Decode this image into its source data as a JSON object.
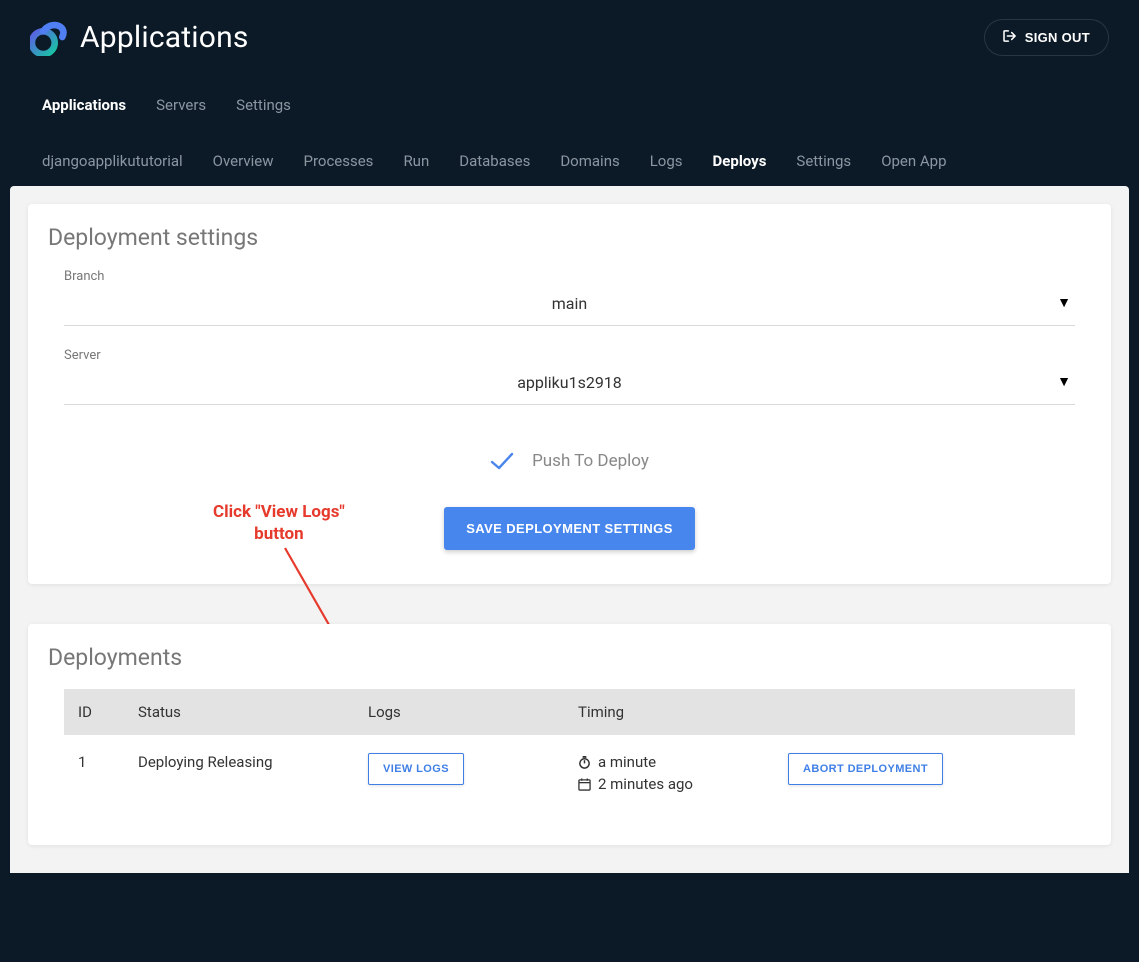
{
  "header": {
    "title": "Applications",
    "signout_label": "SIGN OUT"
  },
  "top_nav": [
    {
      "label": "Applications",
      "active": true
    },
    {
      "label": "Servers",
      "active": false
    },
    {
      "label": "Settings",
      "active": false
    }
  ],
  "sub_nav": [
    {
      "label": "djangoapplikututorial",
      "active": false
    },
    {
      "label": "Overview",
      "active": false
    },
    {
      "label": "Processes",
      "active": false
    },
    {
      "label": "Run",
      "active": false
    },
    {
      "label": "Databases",
      "active": false
    },
    {
      "label": "Domains",
      "active": false
    },
    {
      "label": "Logs",
      "active": false
    },
    {
      "label": "Deploys",
      "active": true
    },
    {
      "label": "Settings",
      "active": false
    },
    {
      "label": "Open App",
      "active": false
    }
  ],
  "deployment_settings": {
    "title": "Deployment settings",
    "branch_label": "Branch",
    "branch_value": "main",
    "server_label": "Server",
    "server_value": "appliku1s2918",
    "push_to_deploy_label": "Push To Deploy",
    "push_to_deploy_checked": true,
    "save_button": "SAVE DEPLOYMENT SETTINGS"
  },
  "annotation": {
    "line1": "Click \"View Logs\"",
    "line2": "button"
  },
  "deployments": {
    "title": "Deployments",
    "columns": [
      "ID",
      "Status",
      "Logs",
      "Timing",
      ""
    ],
    "rows": [
      {
        "id": "1",
        "status": "Deploying Releasing",
        "view_logs_label": "VIEW LOGS",
        "timing_duration": "a minute",
        "timing_started": "2 minutes ago",
        "abort_label": "ABORT DEPLOYMENT"
      }
    ]
  }
}
